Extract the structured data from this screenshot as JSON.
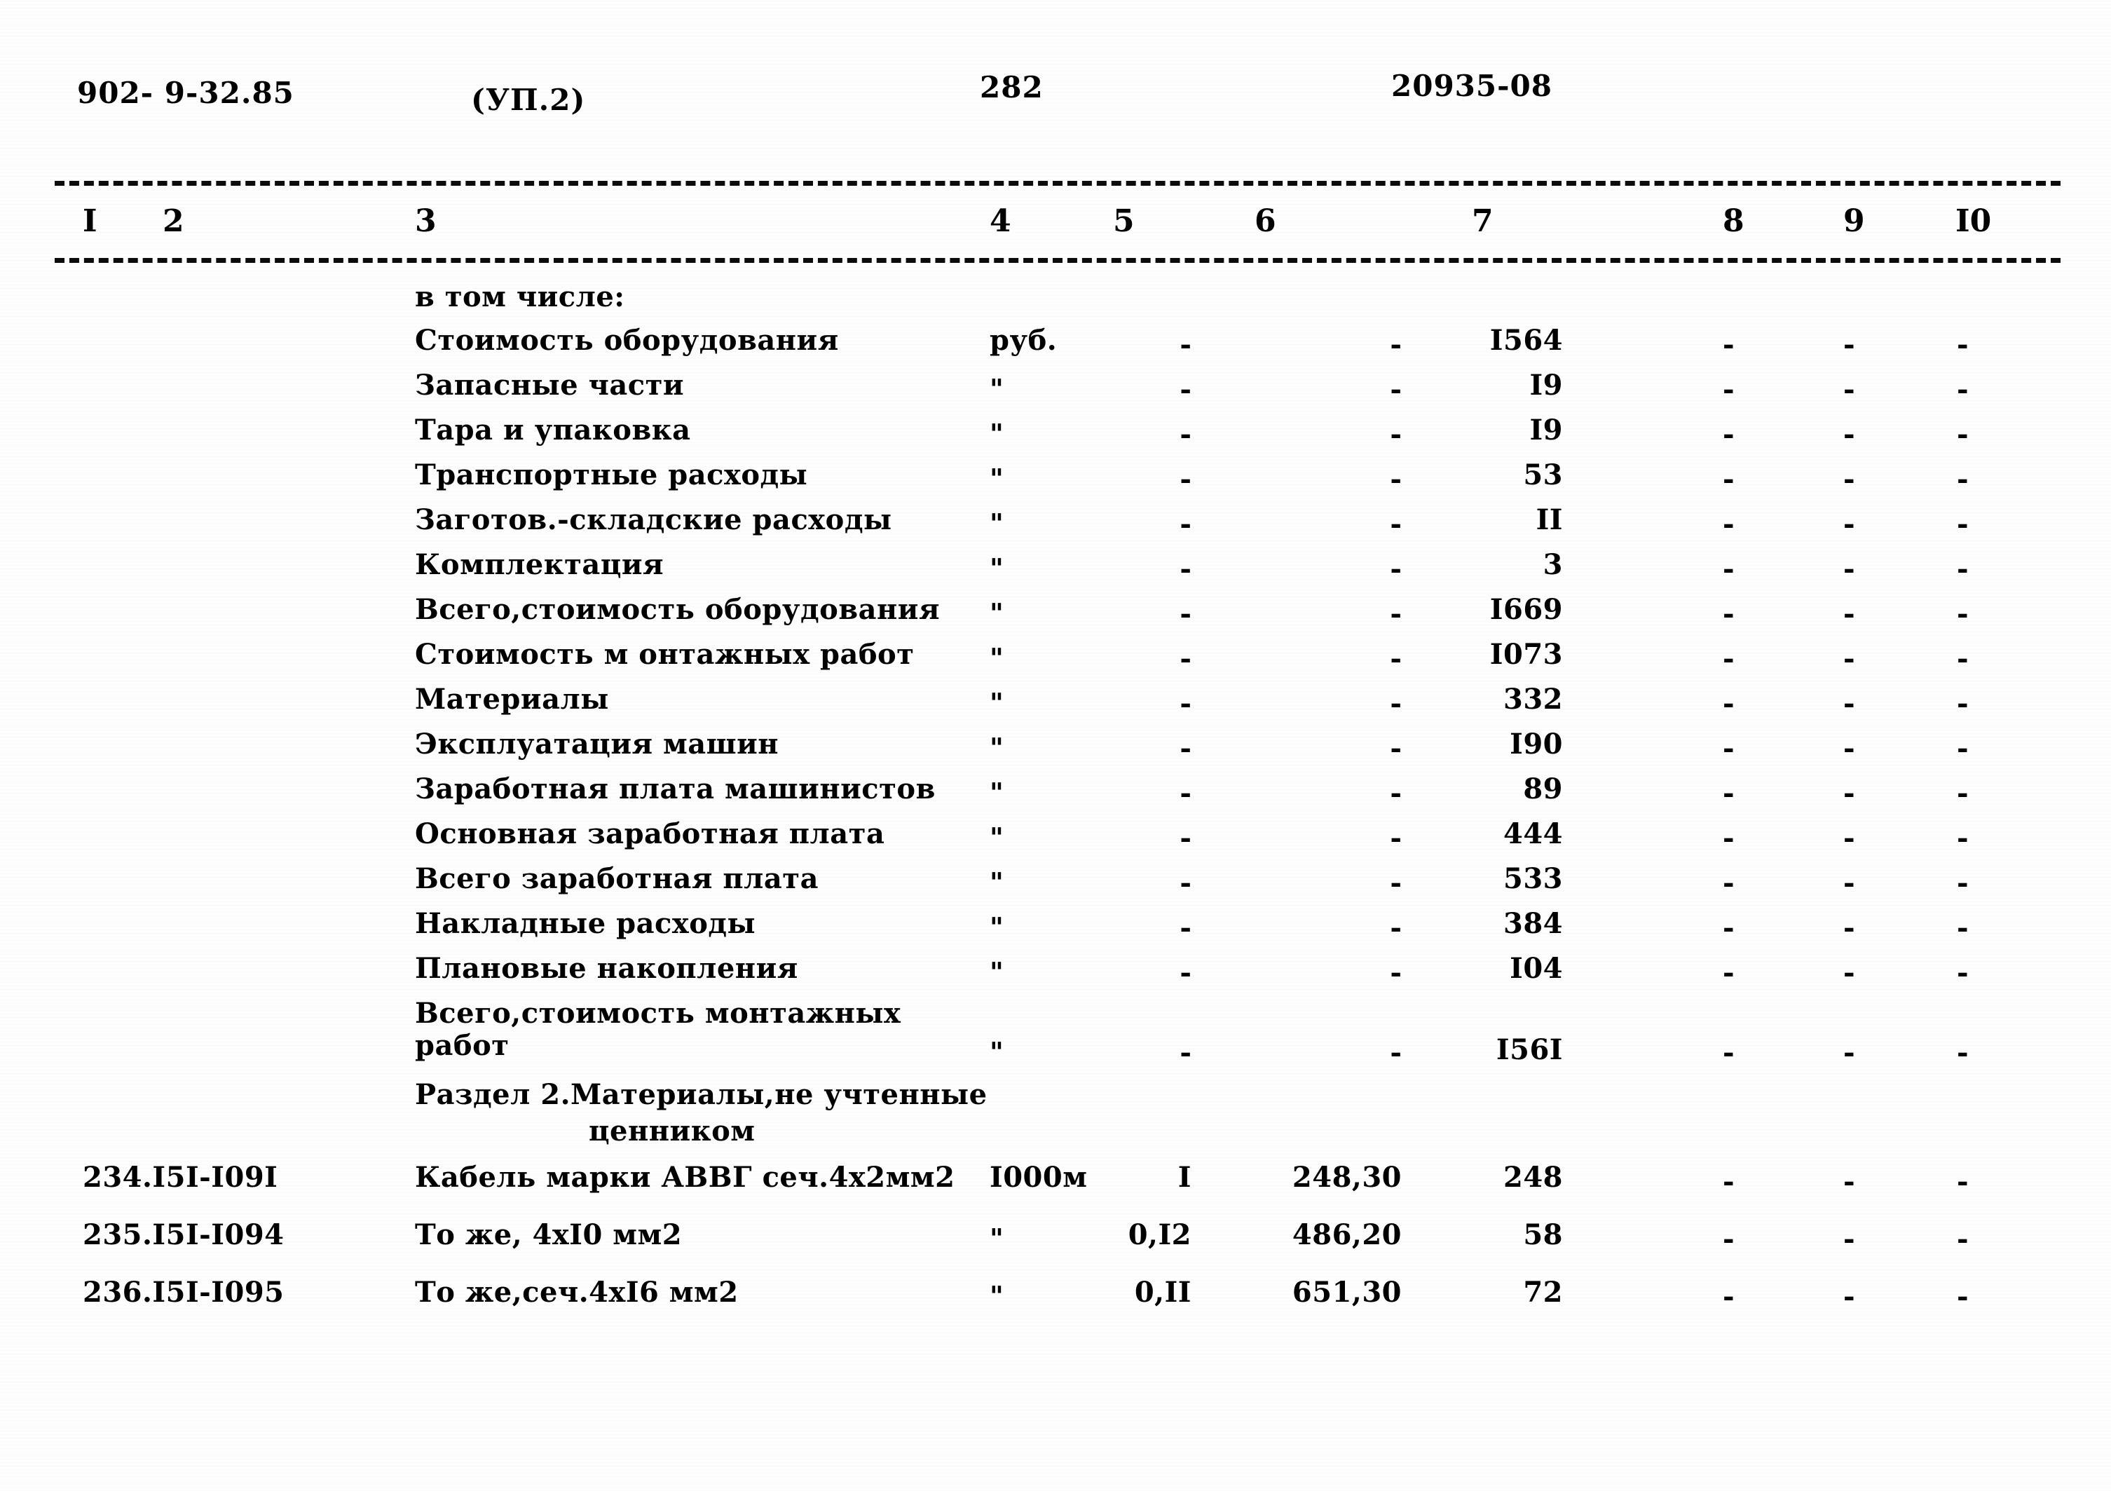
{
  "header": {
    "doc_number": "902- 9-32.85",
    "part": "(УП.2)",
    "page_number": "282",
    "code": "20935-08"
  },
  "column_numbers": [
    "I",
    "2",
    "3",
    "4",
    "5",
    "6",
    "7",
    "8",
    "9",
    "I0"
  ],
  "rows": [
    {
      "kind": "subheading",
      "c3": "в том числе:"
    },
    {
      "kind": "data",
      "c3": "Стоимость оборудования",
      "c4": "руб.",
      "c5": "-",
      "c6": "-",
      "c7": "I564",
      "c8": "-",
      "c9": "-",
      "c10": "-"
    },
    {
      "kind": "data",
      "c3": "Запасные части",
      "c4": "\"",
      "c5": "-",
      "c6": "-",
      "c7": "I9",
      "c8": "-",
      "c9": "-",
      "c10": "-"
    },
    {
      "kind": "data",
      "c3": "Тара и упаковка",
      "c4": "\"",
      "c5": "-",
      "c6": "-",
      "c7": "I9",
      "c8": "-",
      "c9": "-",
      "c10": "-"
    },
    {
      "kind": "data",
      "c3": "Транспортные расходы",
      "c4": "\"",
      "c5": "-",
      "c6": "-",
      "c7": "53",
      "c8": "-",
      "c9": "-",
      "c10": "-"
    },
    {
      "kind": "data",
      "c3": "Заготов.-складские расходы",
      "c4": "\"",
      "c5": "-",
      "c6": "-",
      "c7": "II",
      "c8": "-",
      "c9": "-",
      "c10": "-"
    },
    {
      "kind": "data",
      "c3": "Комплектация",
      "c4": "\"",
      "c5": "-",
      "c6": "-",
      "c7": "3",
      "c8": "-",
      "c9": "-",
      "c10": "-"
    },
    {
      "kind": "data",
      "c3": "Всего,стоимость оборудования",
      "c4": "\"",
      "c5": "-",
      "c6": "-",
      "c7": "I669",
      "c8": "-",
      "c9": "-",
      "c10": "-"
    },
    {
      "kind": "data",
      "c3": "Стоимость м онтажных работ",
      "c4": "\"",
      "c5": "-",
      "c6": "-",
      "c7": "I073",
      "c8": "-",
      "c9": "-",
      "c10": "-"
    },
    {
      "kind": "data",
      "c3": "Материалы",
      "c4": "\"",
      "c5": "-",
      "c6": "-",
      "c7": "332",
      "c8": "-",
      "c9": "-",
      "c10": "-"
    },
    {
      "kind": "data",
      "c3": "Эксплуатация машин",
      "c4": "\"",
      "c5": "-",
      "c6": "-",
      "c7": "I90",
      "c8": "-",
      "c9": "-",
      "c10": "-"
    },
    {
      "kind": "data",
      "c3": "Заработная плата машинистов",
      "c4": "\"",
      "c5": "-",
      "c6": "-",
      "c7": "89",
      "c8": "-",
      "c9": "-",
      "c10": "-"
    },
    {
      "kind": "data",
      "c3": "Основная заработная плата",
      "c4": "\"",
      "c5": "-",
      "c6": "-",
      "c7": "444",
      "c8": "-",
      "c9": "-",
      "c10": "-"
    },
    {
      "kind": "data",
      "c3": "Всего заработная плата",
      "c4": "\"",
      "c5": "-",
      "c6": "-",
      "c7": "533",
      "c8": "-",
      "c9": "-",
      "c10": "-"
    },
    {
      "kind": "data",
      "c3": "Накладные расходы",
      "c4": "\"",
      "c5": "-",
      "c6": "-",
      "c7": "384",
      "c8": "-",
      "c9": "-",
      "c10": "-"
    },
    {
      "kind": "data",
      "c3": "Плановые накопления",
      "c4": "\"",
      "c5": "-",
      "c6": "-",
      "c7": "I04",
      "c8": "-",
      "c9": "-",
      "c10": "-"
    },
    {
      "kind": "data-two-line",
      "c3_line1": "Всего,стоимость монтажных",
      "c3_line2": "работ",
      "c4": "\"",
      "c5": "-",
      "c6": "-",
      "c7": "I56I",
      "c8": "-",
      "c9": "-",
      "c10": "-"
    },
    {
      "kind": "section",
      "c3_line1": "Раздел 2.Материалы,не учтенные",
      "c3_line2": "ценником"
    },
    {
      "kind": "data",
      "c1": "234.I5I-I09I",
      "c3": "Кабель марки АВВГ сеч.4х2мм2",
      "c4": "I000м",
      "c5": "I",
      "c6": "248,30",
      "c7": "248",
      "c8": "-",
      "c9": "-",
      "c10": "-"
    },
    {
      "kind": "data",
      "c1": "235.I5I-I094",
      "c3": "То же, 4хI0 мм2",
      "c4": "\"",
      "c5": "0,I2",
      "c6": "486,20",
      "c7": "58",
      "c8": "-",
      "c9": "-",
      "c10": "-"
    },
    {
      "kind": "data",
      "c1": "236.I5I-I095",
      "c3": "То же,сеч.4хI6 мм2",
      "c4": "\"",
      "c5": "0,II",
      "c6": "651,30",
      "c7": "72",
      "c8": "-",
      "c9": "-",
      "c10": "-"
    }
  ]
}
